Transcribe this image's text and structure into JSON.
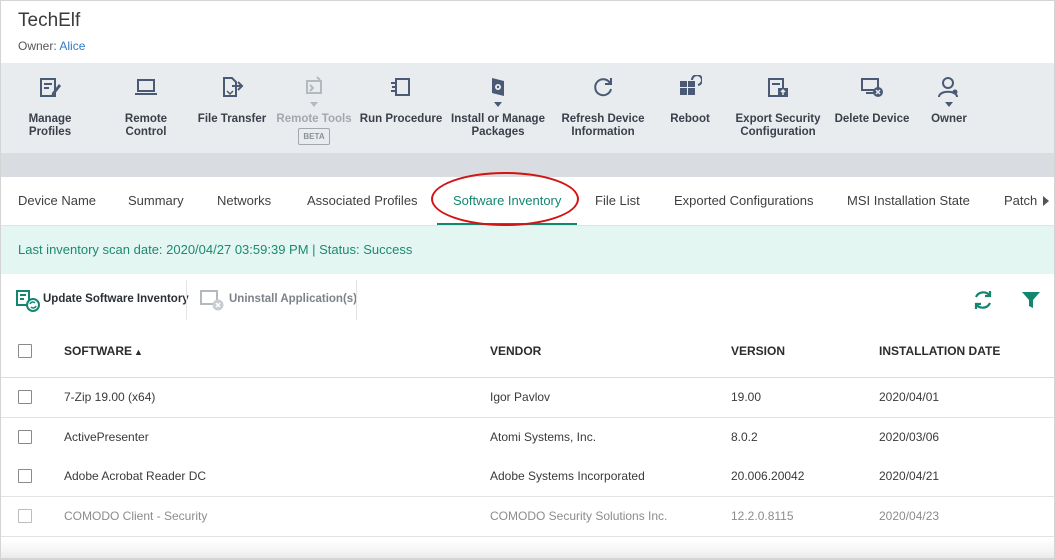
{
  "header": {
    "title": "TechElf",
    "owner_label": "Owner:",
    "owner_name": "Alice"
  },
  "toolbar": {
    "manage_profiles": "Manage Profiles",
    "remote_control": "Remote Control",
    "file_transfer": "File Transfer",
    "remote_tools": "Remote Tools",
    "remote_tools_badge": "BETA",
    "run_procedure": "Run Procedure",
    "install_packages_1": "Install or Manage",
    "install_packages_2": "Packages",
    "refresh_1": "Refresh Device",
    "refresh_2": "Information",
    "reboot": "Reboot",
    "export_1": "Export Security",
    "export_2": "Configuration",
    "delete_device": "Delete Device",
    "owner": "Owner"
  },
  "tabs": {
    "device_name": "Device Name",
    "summary": "Summary",
    "networks": "Networks",
    "associated_profiles": "Associated Profiles",
    "software_inventory": "Software Inventory",
    "file_list": "File List",
    "exported_configurations": "Exported Configurations",
    "msi_installation_state": "MSI Installation State",
    "patch": "Patch"
  },
  "status": {
    "text": "Last inventory scan date: 2020/04/27 03:59:39 PM | Status: Success"
  },
  "actions": {
    "update_inventory": "Update Software Inventory",
    "uninstall": "Uninstall Application(s)"
  },
  "table": {
    "headers": {
      "software": "SOFTWARE",
      "sort_indicator": "▲",
      "vendor": "VENDOR",
      "version": "VERSION",
      "installation_date": "INSTALLATION DATE"
    },
    "rows": [
      {
        "software": "7-Zip 19.00 (x64)",
        "vendor": "Igor Pavlov",
        "version": "19.00",
        "date": "2020/04/01"
      },
      {
        "software": "ActivePresenter",
        "vendor": "Atomi Systems, Inc.",
        "version": "8.0.2",
        "date": "2020/03/06"
      },
      {
        "software": "Adobe Acrobat Reader DC",
        "vendor": "Adobe Systems Incorporated",
        "version": "20.006.20042",
        "date": "2020/04/21"
      },
      {
        "software": "COMODO Client - Security",
        "vendor": "COMODO Security Solutions Inc.",
        "version": "12.2.0.8115",
        "date": "2020/04/23"
      }
    ]
  },
  "colors": {
    "accent": "#13866f",
    "link": "#2d7cc4",
    "highlight_oval": "#d21414",
    "status_bg": "#e4f6f1",
    "toolbar_bg": "#e9ecef"
  }
}
